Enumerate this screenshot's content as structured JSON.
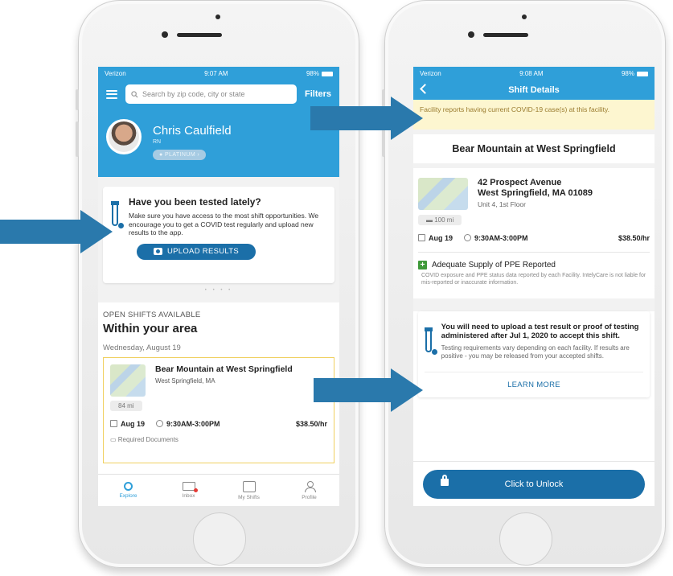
{
  "left_phone": {
    "status": {
      "carrier": "Verizon",
      "time": "9:07 AM",
      "battery": "98%"
    },
    "search": {
      "placeholder": "Search by zip code, city or state",
      "filters_label": "Filters"
    },
    "profile": {
      "name": "Chris Caulfield",
      "role": "RN",
      "badge": "PLATINUM"
    },
    "test_card": {
      "title": "Have you been tested lately?",
      "body": "Make sure you have access to the most shift opportunities. We encourage you to get a COVID test regularly and upload new results to the app.",
      "button": "UPLOAD RESULTS"
    },
    "pager": "• • • •",
    "shifts": {
      "section_label": "OPEN SHIFTS AVAILABLE",
      "section_title": "Within your area",
      "date_label": "Wednesday, August 19",
      "card": {
        "name": "Bear Mountain at West Springfield",
        "address": "West Springfield, MA",
        "distance": "84 mi",
        "date": "Aug 19",
        "time": "9:30AM-3:00PM",
        "rate": "$38.50/hr",
        "required": "Required Documents"
      }
    },
    "tabs": [
      {
        "label": "Explore",
        "icon": "search-icon"
      },
      {
        "label": "Inbox",
        "icon": "mail-icon"
      },
      {
        "label": "My Shifts",
        "icon": "calendar-icon"
      },
      {
        "label": "Profile",
        "icon": "person-icon"
      }
    ]
  },
  "right_phone": {
    "status": {
      "carrier": "Verizon",
      "time": "9:08 AM",
      "battery": "98%"
    },
    "nav_title": "Shift Details",
    "alert": "Facility reports having current COVID-19 case(s) at this facility.",
    "facility_title": "Bear Mountain at West Springfield",
    "address_line1": "42 Prospect Avenue",
    "address_line2": "West Springfield, MA 01089",
    "address_line3": "Unit 4, 1st Floor",
    "distance": "100 mi",
    "date": "Aug 19",
    "time": "9:30AM-3:00PM",
    "rate": "$38.50/hr",
    "ppe_label": "Adequate Supply of PPE Reported",
    "ppe_note": "COVID exposure and PPE status data reported by each Facility. IntelyCare is not liable for mis-reported or inaccurate information.",
    "upload_notice": "You will need to upload a test result or proof of testing administered after Jul 1, 2020 to accept this shift.",
    "upload_note": "Testing requirements vary depending on each facility. If results are positive - you may be released from your accepted shifts.",
    "learn_more": "LEARN MORE",
    "unlock_button": "Click to Unlock"
  },
  "colors": {
    "header_blue": "#2f9fd9",
    "button_blue": "#1b6fa8",
    "arrow_blue": "#2a79ac",
    "alert_yellow": "#fdf6d0"
  }
}
